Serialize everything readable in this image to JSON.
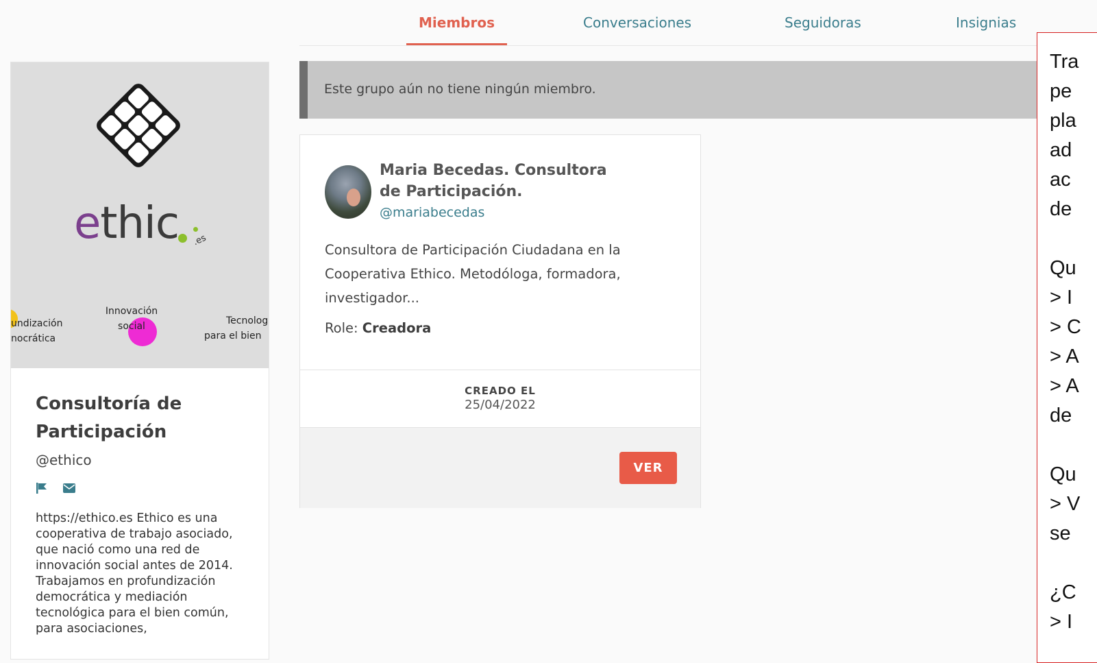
{
  "tabs": [
    {
      "label": "Miembros",
      "active": true
    },
    {
      "label": "Conversaciones",
      "active": false
    },
    {
      "label": "Seguidoras",
      "active": false
    },
    {
      "label": "Insignias",
      "active": false
    }
  ],
  "profile": {
    "banner": {
      "logo_e": "e",
      "logo_thic": "thic",
      "logo_suffix": ".es",
      "label_left_1": "undización",
      "label_left_2": "nocrática",
      "label_mid_1": "Innovación",
      "label_mid_2": "social",
      "label_right_1": "Tecnologí",
      "label_right_2": "para el bien"
    },
    "name": "Consultoría de Participación",
    "handle": "@ethico",
    "description": "https://ethico.es Ethico es una cooperativa de trabajo asociado, que nació como una red de innovación social antes de 2014. Trabajamos en profundización democrática y mediación tecnológica para el bien común, para asociaciones,"
  },
  "notice": {
    "text": "Este grupo aún no tiene ningún miembro."
  },
  "member": {
    "name": "Maria Becedas. Consultora de Participación.",
    "handle": "@mariabecedas",
    "bio": "Consultora de Participación Ciudadana en la Cooperativa Ethico. Metodóloga, formadora, investigador...",
    "role_label": "Role:",
    "role_value": "Creadora",
    "created_label": "CREADO EL",
    "created_date": "25/04/2022",
    "view_button": "VER"
  },
  "annotation": {
    "lines": [
      "Tra",
      "pe",
      "pla",
      "ad",
      "ac",
      "de",
      "",
      "Qu",
      "> I",
      "> C",
      "> A",
      "> A",
      "de",
      "",
      "Qu",
      "> V",
      "se",
      "",
      "¿C",
      "> I"
    ]
  },
  "colors": {
    "accent": "#e0614f",
    "link": "#3a7d8c",
    "button": "#e85b48",
    "annotation_border": "#d61f1f"
  }
}
